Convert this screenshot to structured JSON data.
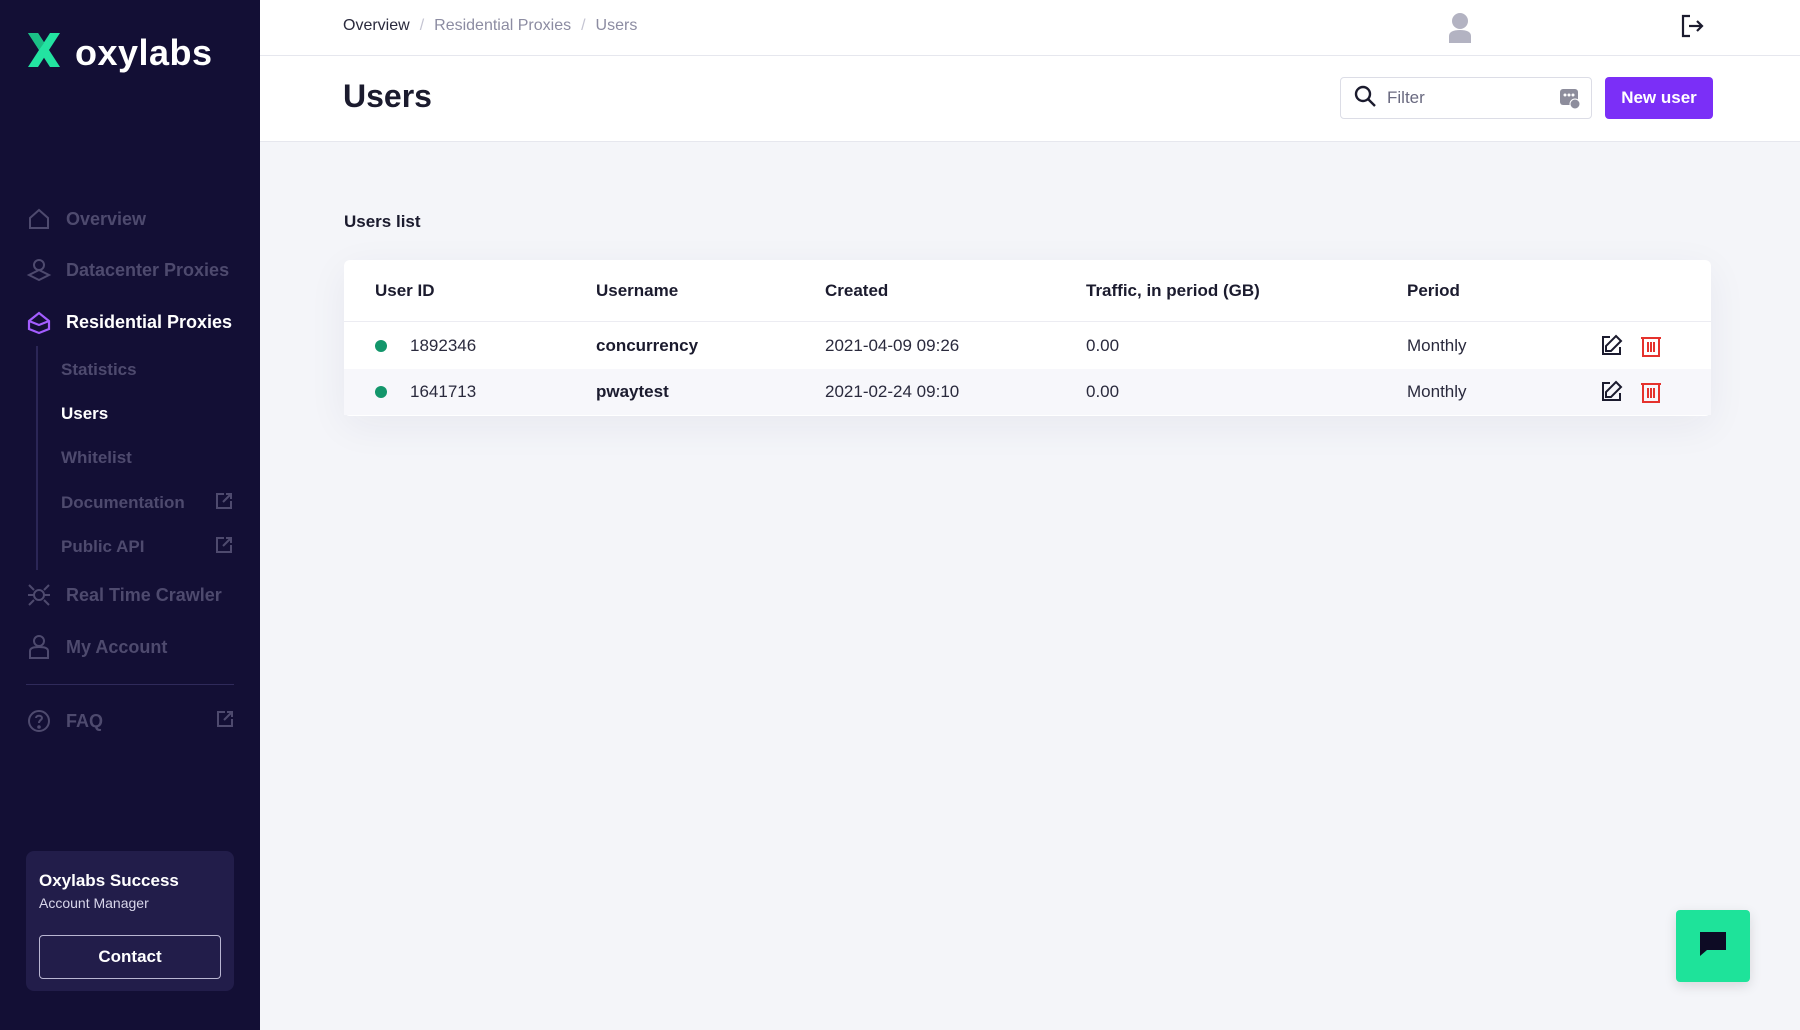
{
  "brand": {
    "name": "oxylabs",
    "logo_color": "#23e3a1"
  },
  "sidebar": {
    "nav": [
      {
        "label": "Overview",
        "icon": "home-icon",
        "active": false
      },
      {
        "label": "Datacenter Proxies",
        "icon": "datacenter-icon",
        "active": false
      },
      {
        "label": "Residential Proxies",
        "icon": "residential-icon",
        "active": true
      }
    ],
    "sub": [
      {
        "label": "Statistics",
        "active": false,
        "external": false
      },
      {
        "label": "Users",
        "active": true,
        "external": false
      },
      {
        "label": "Whitelist",
        "active": false,
        "external": false
      },
      {
        "label": "Documentation",
        "active": false,
        "external": true
      },
      {
        "label": "Public API",
        "active": false,
        "external": true
      }
    ],
    "nav2": [
      {
        "label": "Real Time Crawler",
        "icon": "crawler-icon"
      },
      {
        "label": "My Account",
        "icon": "account-icon"
      }
    ],
    "faq": {
      "label": "FAQ",
      "icon": "help-icon",
      "external": true
    },
    "manager": {
      "title": "Oxylabs Success",
      "subtitle": "Account Manager",
      "button": "Contact"
    }
  },
  "breadcrumb": [
    "Overview",
    "Residential Proxies",
    "Users"
  ],
  "header": {
    "title": "Users",
    "filter_placeholder": "Filter",
    "new_button": "New user",
    "accent": "#7b2ff7"
  },
  "users": {
    "title": "Users list",
    "columns": [
      "User ID",
      "Username",
      "Created",
      "Traffic, in period (GB)",
      "Period"
    ],
    "rows": [
      {
        "id": "1892346",
        "username": "concurrency",
        "created": "2021-04-09 09:26",
        "traffic": "0.00",
        "period": "Monthly",
        "status": "active"
      },
      {
        "id": "1641713",
        "username": "pwaytest",
        "created": "2021-02-24 09:10",
        "traffic": "0.00",
        "period": "Monthly",
        "status": "active"
      }
    ],
    "status_color": "#13966b",
    "delete_color": "#e5322d"
  }
}
